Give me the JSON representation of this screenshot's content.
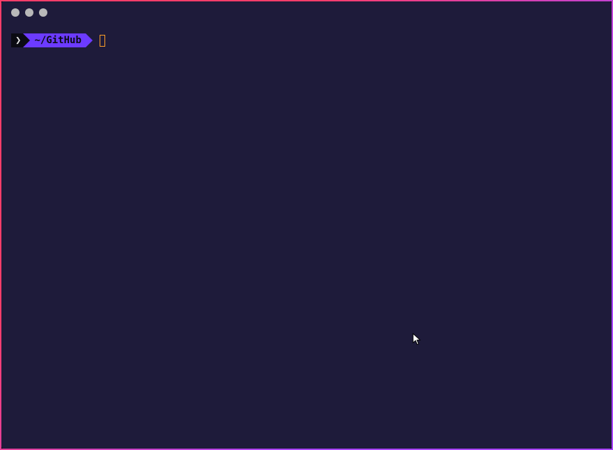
{
  "titlebar": {
    "traffic_lights": [
      "close",
      "minimize",
      "zoom"
    ]
  },
  "prompt": {
    "symbol": "❯",
    "path": "~/GitHub",
    "command": ""
  },
  "colors": {
    "bg": "#1e1b3a",
    "border_start": "#ff3d6a",
    "border_end": "#a944ff",
    "segment_dark": "#0b0b13",
    "segment_accent": "#6c3bff",
    "cursor": "#ffa028"
  }
}
